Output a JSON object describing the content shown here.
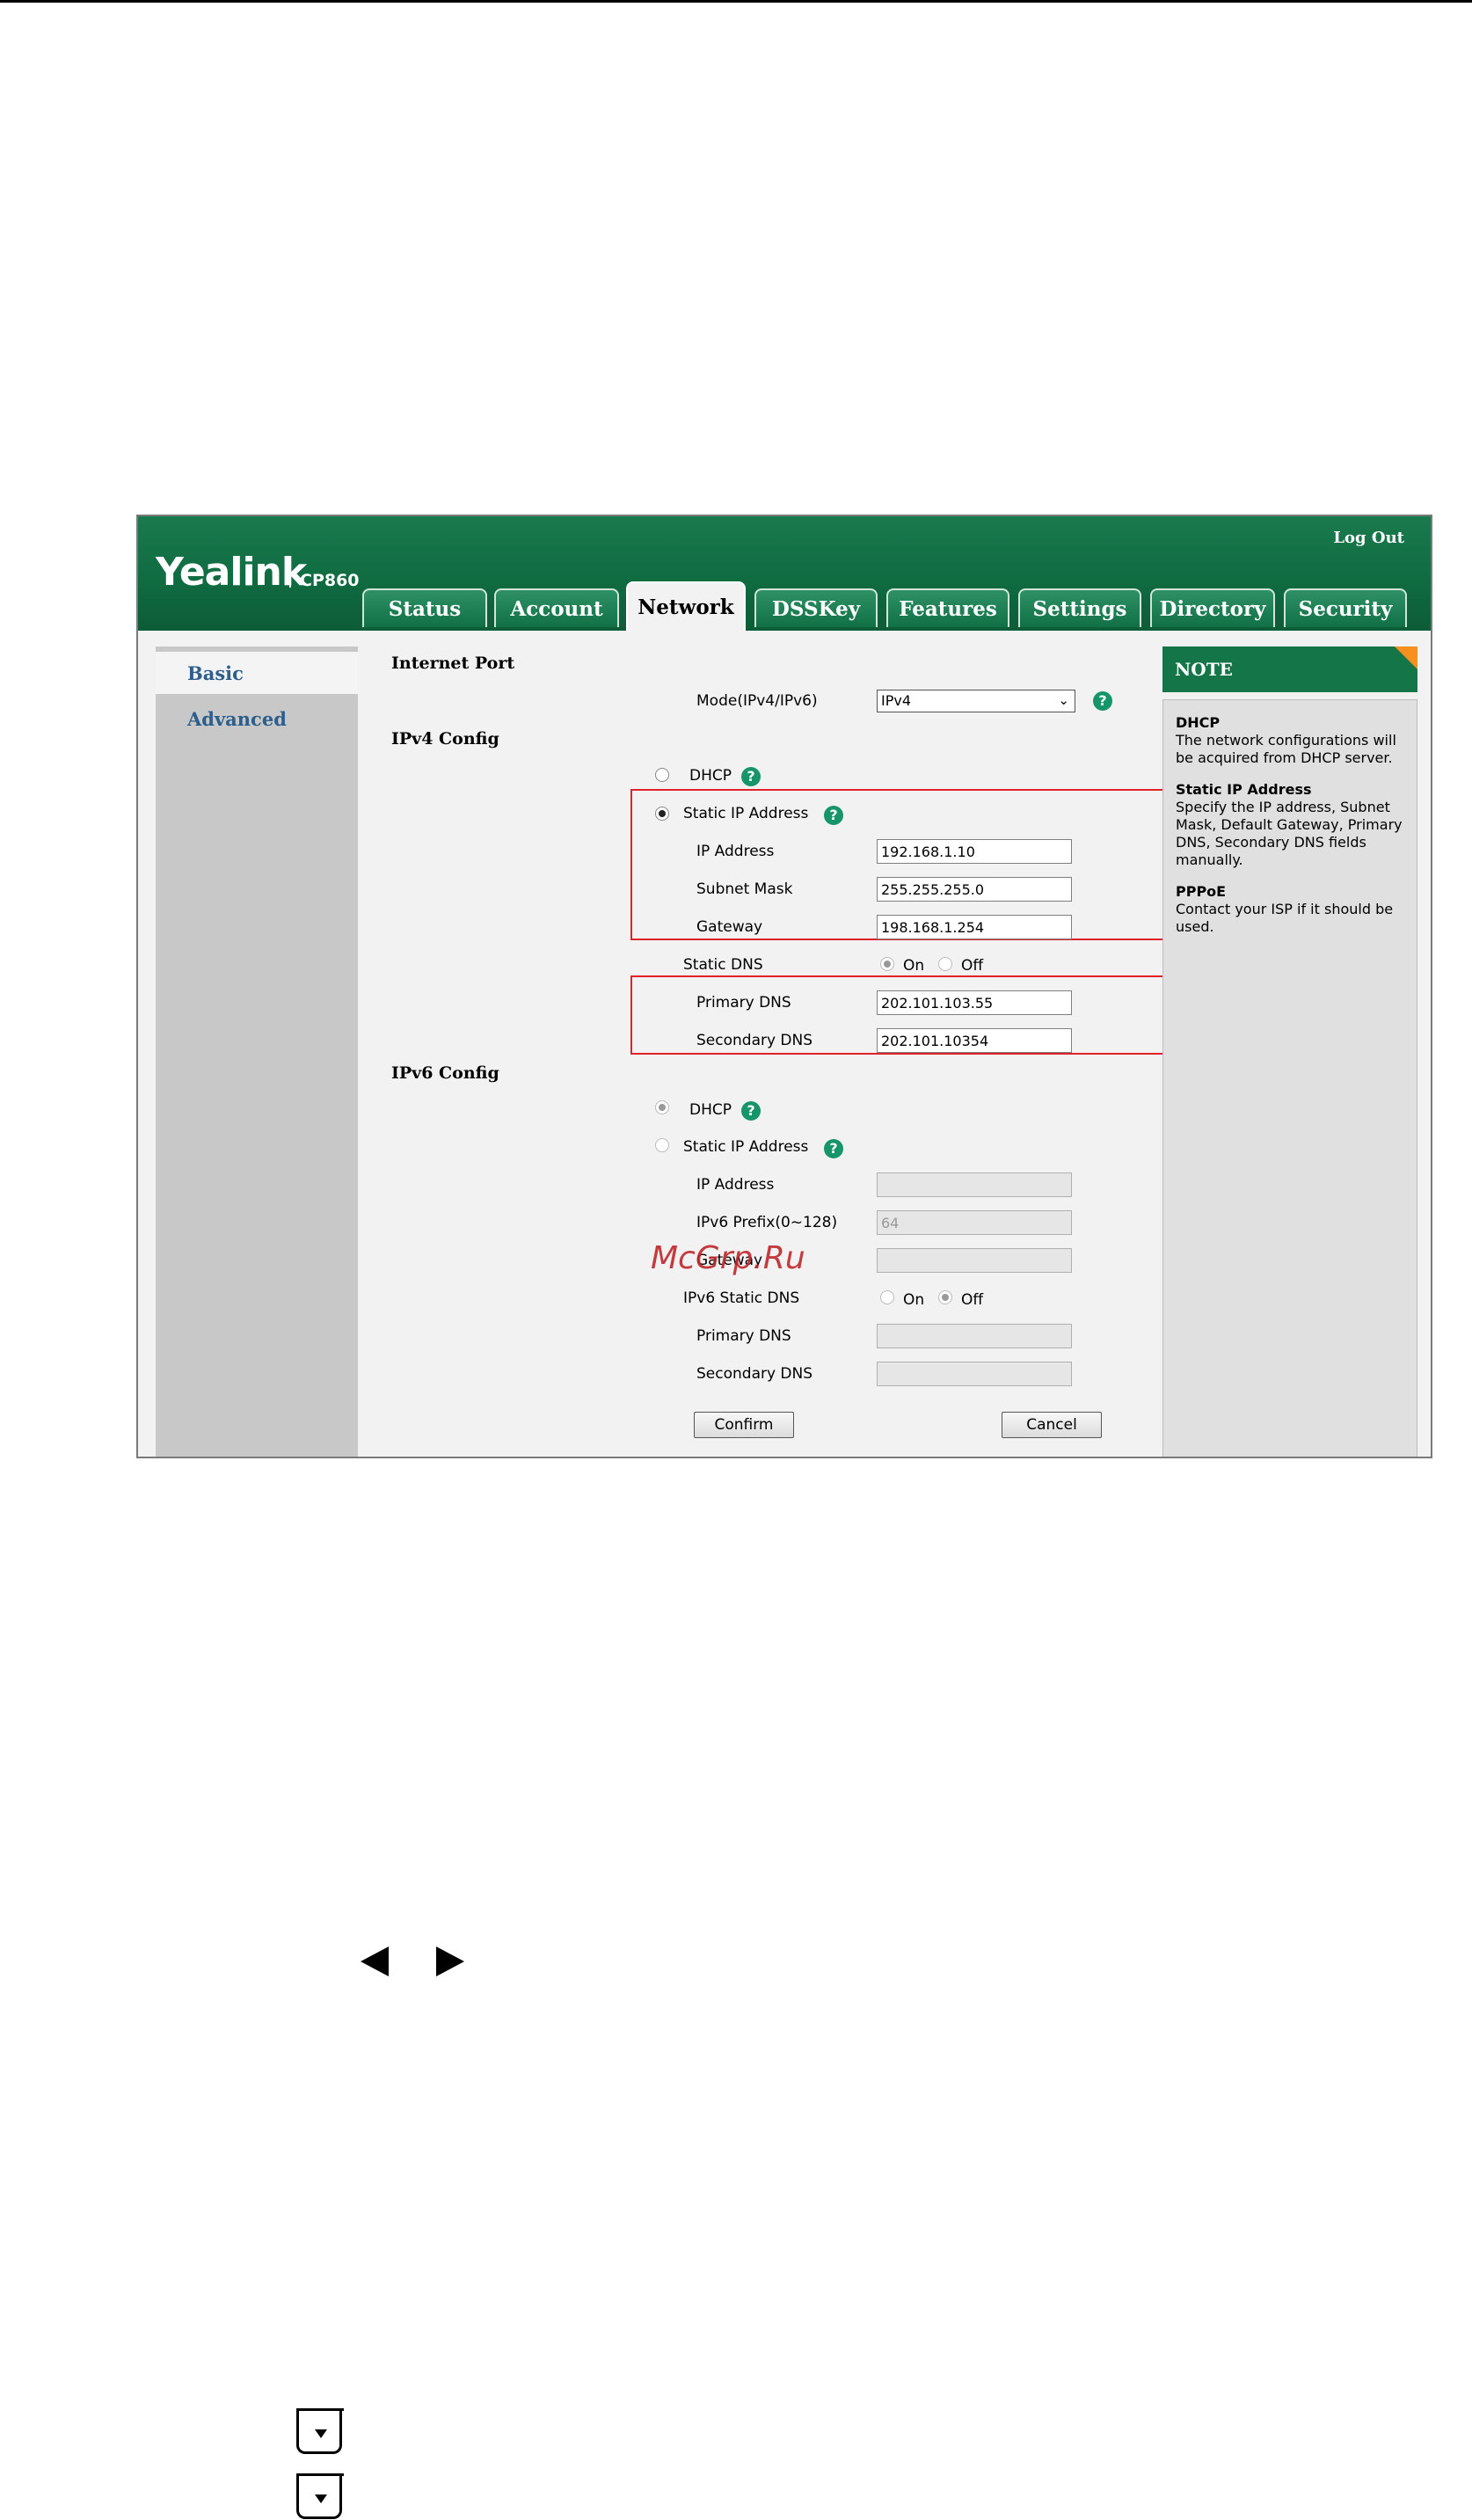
{
  "header": {
    "logo": "Yealink",
    "model": "CP860",
    "logout": "Log Out",
    "tabs": [
      "Status",
      "Account",
      "Network",
      "DSSKey",
      "Features",
      "Settings",
      "Directory",
      "Security"
    ]
  },
  "leftnav": {
    "items": [
      "Basic",
      "Advanced"
    ]
  },
  "form": {
    "internet_port": "Internet Port",
    "mode_label": "Mode(IPv4/IPv6)",
    "mode_value": "IPv4",
    "ipv4": {
      "title": "IPv4 Config",
      "dhcp": "DHCP",
      "static_ip": "Static IP Address",
      "ip_label": "IP Address",
      "ip_value": "192.168.1.10",
      "mask_label": "Subnet Mask",
      "mask_value": "255.255.255.0",
      "gateway_label": "Gateway",
      "gateway_value": "198.168.1.254",
      "static_dns": "Static DNS",
      "on": "On",
      "off": "Off",
      "primary_dns_label": "Primary DNS",
      "primary_dns_value": "202.101.103.55",
      "secondary_dns_label": "Secondary DNS",
      "secondary_dns_value": "202.101.10354"
    },
    "ipv6": {
      "title": "IPv6 Config",
      "dhcp": "DHCP",
      "static_ip": "Static IP Address",
      "ip_label": "IP Address",
      "prefix_label": "IPv6 Prefix(0~128)",
      "prefix_value": "64",
      "gateway_label": "Gateway",
      "static_dns": "IPv6 Static DNS",
      "on": "On",
      "off": "Off",
      "primary_dns_label": "Primary DNS",
      "secondary_dns_label": "Secondary DNS"
    },
    "confirm": "Confirm",
    "cancel": "Cancel"
  },
  "note": {
    "title": "NOTE",
    "items": [
      {
        "title": "DHCP",
        "text": "The network configurations will be acquired from DHCP server."
      },
      {
        "title": "Static IP Address",
        "text": "Specify the IP address, Subnet Mask, Default Gateway, Primary DNS, Secondary DNS fields manually."
      },
      {
        "title": "PPPoE",
        "text": "Contact your ISP if it should be used."
      }
    ]
  },
  "watermark": "McGrp.Ru",
  "icons": [
    "help-icon",
    "arrow-left-icon",
    "arrow-right-icon",
    "down-key-icon"
  ],
  "colors": {
    "header_green": "#0f6a40",
    "accent_orange": "#f7901e",
    "highlight_red": "#e0202a",
    "help_teal": "#17956a"
  }
}
